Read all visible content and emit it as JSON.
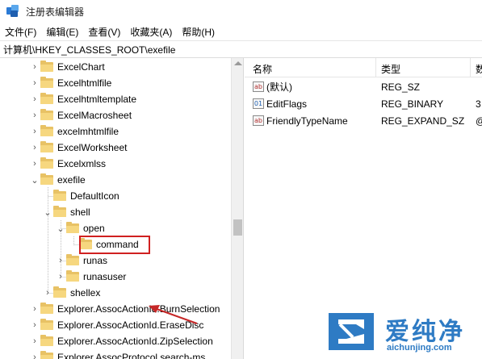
{
  "window": {
    "title": "注册表编辑器"
  },
  "menu": [
    "文件(F)",
    "编辑(E)",
    "查看(V)",
    "收藏夹(A)",
    "帮助(H)"
  ],
  "address": "计算机\\HKEY_CLASSES_ROOT\\exefile",
  "tree": [
    {
      "label": "ExcelChart",
      "chevron": "right"
    },
    {
      "label": "Excelhtmlfile",
      "chevron": "right"
    },
    {
      "label": "Excelhtmltemplate",
      "chevron": "right"
    },
    {
      "label": "ExcelMacrosheet",
      "chevron": "right"
    },
    {
      "label": "excelmhtmlfile",
      "chevron": "right"
    },
    {
      "label": "ExcelWorksheet",
      "chevron": "right"
    },
    {
      "label": "Excelxmlss",
      "chevron": "right"
    },
    {
      "label": "exefile",
      "chevron": "down"
    },
    {
      "label": "DefaultIcon",
      "chevron": ""
    },
    {
      "label": "shell",
      "chevron": "down"
    },
    {
      "label": "open",
      "chevron": "down"
    },
    {
      "label": "command",
      "chevron": ""
    },
    {
      "label": "runas",
      "chevron": "right"
    },
    {
      "label": "runasuser",
      "chevron": "right"
    },
    {
      "label": "shellex",
      "chevron": "right"
    },
    {
      "label": "Explorer.AssocActionId.BurnSelection",
      "chevron": "right"
    },
    {
      "label": "Explorer.AssocActionId.EraseDisc",
      "chevron": "right"
    },
    {
      "label": "Explorer.AssocActionId.ZipSelection",
      "chevron": "right"
    },
    {
      "label": "Explorer.AssocProtocol.search-ms",
      "chevron": "right"
    }
  ],
  "list": {
    "headers": {
      "name": "名称",
      "type": "类型",
      "data": "数"
    },
    "rows": [
      {
        "icon": "string-value-icon",
        "name": "(默认)",
        "type": "REG_SZ",
        "data": ""
      },
      {
        "icon": "binary-value-icon",
        "name": "EditFlags",
        "type": "REG_BINARY",
        "data": "3"
      },
      {
        "icon": "string-value-icon",
        "name": "FriendlyTypeName",
        "type": "REG_EXPAND_SZ",
        "data": "@"
      }
    ]
  },
  "watermark": {
    "cn": "爱纯净",
    "url": "aichunjing.com"
  },
  "colors": {
    "highlight": "#d02020",
    "folder": "#f6d77f",
    "watermark": "#2e7bc4"
  }
}
